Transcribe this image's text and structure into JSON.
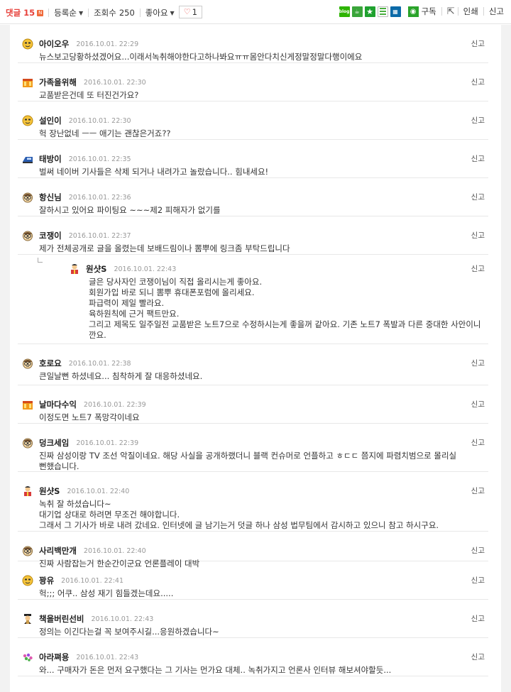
{
  "toolbar": {
    "comment_label": "댓글",
    "comment_count": "15",
    "new_badge": "N",
    "sort_label": "등록순",
    "views_label": "조회수",
    "views_count": "250",
    "like_label": "좋아요",
    "heart_count": "1",
    "share_icons": [
      "blog",
      "cafe",
      "star",
      "band",
      "grid"
    ],
    "subscribe_label": "구독",
    "print_label": "인쇄",
    "report_label": "신고"
  },
  "comments": [
    {
      "nick": "아이오우",
      "date": "2016.10.01. 22:29",
      "text": [
        "뉴스보고당황하셨겠어요...이래서녹취해야한다고하나봐요ㅠㅠ몸안다치신게정말정말다행이에요"
      ],
      "report": "신고",
      "avatar": "smiley-icon"
    },
    {
      "nick": "가족을위해",
      "date": "2016.10.01. 22:30",
      "text": [
        "교품받은건데 또 터진건가요?"
      ],
      "report": "신고",
      "avatar": "crown-icon"
    },
    {
      "nick": "설인이",
      "date": "2016.10.01. 22:30",
      "text": [
        "헉 장난없네 ㅡㅡ 애기는 괜찮은거죠??"
      ],
      "report": "신고",
      "avatar": "smiley-icon"
    },
    {
      "nick": "태방이",
      "date": "2016.10.01. 22:35",
      "text": [
        "벌써 네이버 기사들은 삭제 되거나 내려가고 놀랐습니다.. 힘내세요!"
      ],
      "report": "신고",
      "avatar": "train-icon"
    },
    {
      "nick": "항신님",
      "date": "2016.10.01. 22:36",
      "text": [
        "잘하시고 있어요 파이팅요 ~~~제2 피해자가 없기를"
      ],
      "report": "신고",
      "avatar": "glasses-face-icon"
    },
    {
      "nick": "코쟁이",
      "date": "2016.10.01. 22:37",
      "text": [
        "제가 전체공개로 글을 올렸는데 보배드림이나 뽐뿌에 링크좀 부탁드립니다"
      ],
      "report": "신고",
      "avatar": "glasses-face-icon"
    },
    {
      "nick": "원샷S",
      "date": "2016.10.01. 22:43",
      "text": [
        "글은 당사자인 코쟁이님이 직접 올리시는게 좋아요.",
        "회원가입 바로 되니 뽐뿌 휴대폰포럼에 올리세요.",
        "파급력이 제일 빨라요.",
        "육하원칙에 근거 팩트만요.",
        "그리고 제목도 일주일전 교품받은 노트7으로 수정하시는게 좋을꺼 같아요. 기존 노트7 폭발과 다른 중대한 사안이니",
        "깐요."
      ],
      "report": "신고",
      "avatar": "person-icon",
      "is_reply": true
    },
    {
      "nick": "호로요",
      "date": "2016.10.01. 22:38",
      "text": [
        "큰일날뻔 하셨네요... 침착하게 잘 대응하셨네요."
      ],
      "report": "신고",
      "avatar": "glasses-face-icon"
    },
    {
      "nick": "날마다수익",
      "date": "2016.10.01. 22:39",
      "text": [
        "이정도면 노트7 폭망각이네요"
      ],
      "report": "신고",
      "avatar": "crown-icon"
    },
    {
      "nick": "덩크세임",
      "date": "2016.10.01. 22:39",
      "text": [
        "진짜 삼성이랑 TV 조선 악질이네요. 해당 사실을 공개하랬더니 블랙 컨슈머로 언플하고 ㅎㄷㄷ 쯤지에 파렴치범으로 몰리실",
        "뻔했습니다."
      ],
      "report": "신고",
      "avatar": "glasses-face-icon"
    },
    {
      "nick": "원샷S",
      "date": "2016.10.01. 22:40",
      "text": [
        "녹취 잘 하셨습니다~",
        "대기업 상대로 하려면 무조건 해야합니다.",
        "그래서 그 기사가 바로 내려 갔네요. 인터넷에 글 남기는거 덧글 하나 삼성 법무팀에서 감시하고 있으니 참고 하시구요."
      ],
      "report": "신고",
      "avatar": "person-icon"
    },
    {
      "nick": "사리백만개",
      "date": "2016.10.01. 22:40",
      "text": [
        "진짜 사람잡는거 한순간이군요 언론플레이 대박"
      ],
      "report": "신고",
      "avatar": "glasses-face-icon"
    },
    {
      "nick": "꽝유",
      "date": "2016.10.01. 22:41",
      "text": [
        "헉;;; 어쿠.. 삼성 재기 힘들겠는데요....."
      ],
      "report": "신고",
      "avatar": "smiley-icon"
    },
    {
      "nick": "책을버린선비",
      "date": "2016.10.01. 22:43",
      "text": [
        "정의는 이긴다는걸 꼭 보여주시길...응원하겠습니다~"
      ],
      "report": "신고",
      "avatar": "scholar-icon"
    },
    {
      "nick": "아라쪄용",
      "date": "2016.10.01. 22:43",
      "text": [
        "와... 구매자가 돈은 먼저 요구했다는 그 기사는 먼가요 대체.. 녹취가지고 언론사 인터뷰 해보셔야할듯..."
      ],
      "report": "신고",
      "avatar": "flower-icon"
    }
  ]
}
